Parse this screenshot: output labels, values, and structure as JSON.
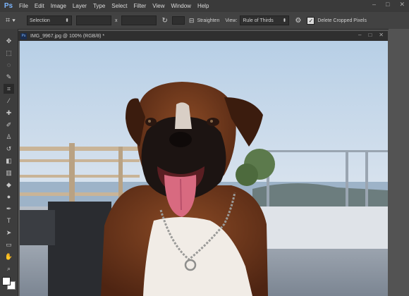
{
  "menubar": {
    "logo": "Ps",
    "items": [
      "File",
      "Edit",
      "Image",
      "Layer",
      "Type",
      "Select",
      "Filter",
      "View",
      "Window",
      "Help"
    ],
    "controls": [
      "–",
      "□",
      "✕"
    ]
  },
  "options": {
    "ratio_value": "Selection",
    "x_label": "x",
    "straighten_label": "Straighten",
    "view_label": "View:",
    "view_value": "Rule of Thirds",
    "delete_label": "Delete Cropped Pixels"
  },
  "document": {
    "tab_title": "IMG_9967.jpg @ 100% (RGB/8) *"
  },
  "colors": {
    "accent": "#31a8ff",
    "menubar": "#3a3a3a",
    "workspace": "#535353"
  }
}
